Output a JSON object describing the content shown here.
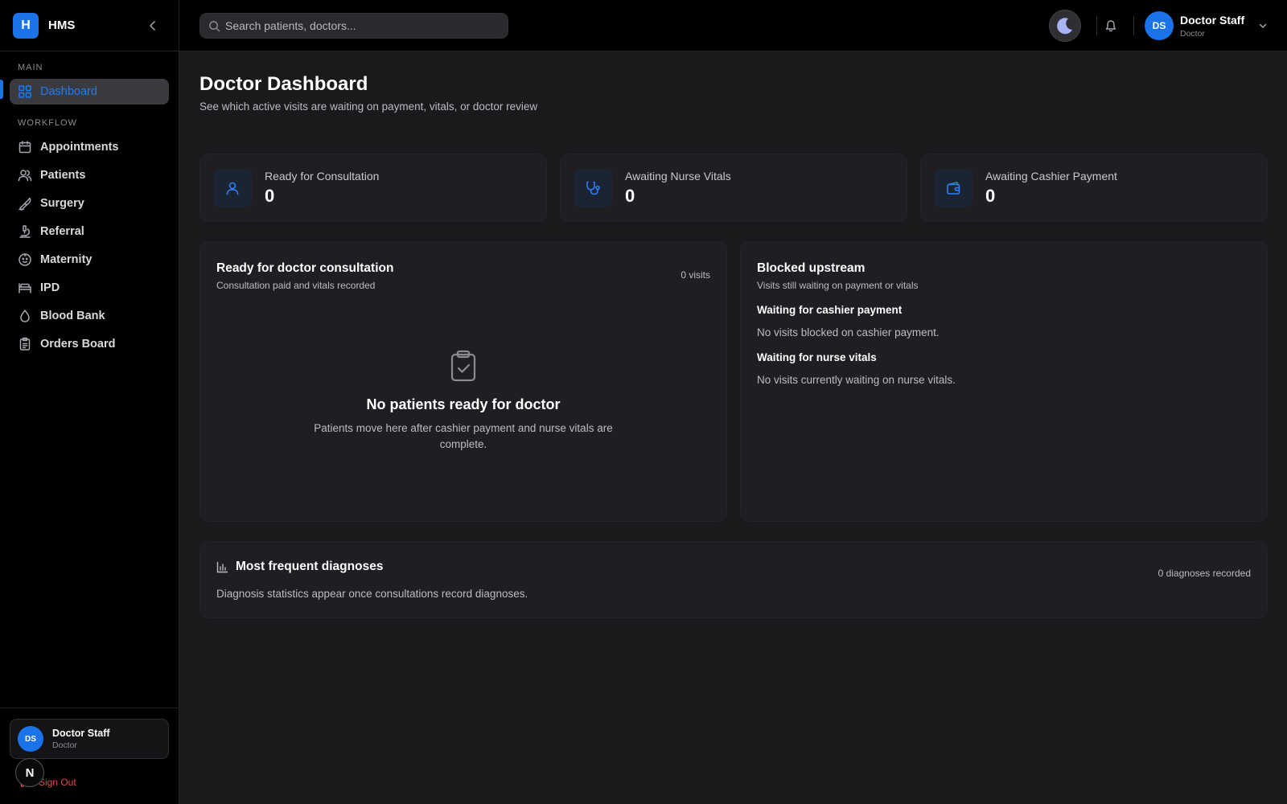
{
  "brand": {
    "logo_letter": "H",
    "name": "HMS"
  },
  "sidebar": {
    "sections": [
      {
        "label": "MAIN"
      },
      {
        "label": "WORKFLOW"
      }
    ],
    "items": [
      {
        "label": "Dashboard",
        "icon": "dashboard-icon"
      },
      {
        "label": "Appointments",
        "icon": "calendar-icon"
      },
      {
        "label": "Patients",
        "icon": "users-icon"
      },
      {
        "label": "Surgery",
        "icon": "scalpel-icon"
      },
      {
        "label": "Referral",
        "icon": "microscope-icon"
      },
      {
        "label": "Maternity",
        "icon": "baby-icon"
      },
      {
        "label": "IPD",
        "icon": "bed-icon"
      },
      {
        "label": "Blood Bank",
        "icon": "droplet-icon"
      },
      {
        "label": "Orders Board",
        "icon": "clipboard-icon"
      }
    ],
    "footer": {
      "avatar_initials": "DS",
      "user_name": "Doctor Staff",
      "user_role": "Doctor",
      "signout_label": "Sign Out",
      "n_badge": "N"
    }
  },
  "header": {
    "search_placeholder": "Search patients, doctors...",
    "profile": {
      "initials": "DS",
      "name": "Doctor Staff",
      "role": "Doctor"
    }
  },
  "page": {
    "title": "Doctor Dashboard",
    "subtitle": "See which active visits are waiting on payment, vitals, or doctor review"
  },
  "stats": [
    {
      "label": "Ready for Consultation",
      "value": "0",
      "icon": "user-icon"
    },
    {
      "label": "Awaiting Nurse Vitals",
      "value": "0",
      "icon": "stethoscope-icon"
    },
    {
      "label": "Awaiting Cashier Payment",
      "value": "0",
      "icon": "wallet-icon"
    }
  ],
  "ready_panel": {
    "title": "Ready for doctor consultation",
    "subtitle": "Consultation paid and vitals recorded",
    "count": "0 visits",
    "empty_title": "No patients ready for doctor",
    "empty_desc": "Patients move here after cashier payment and nurse vitals are complete."
  },
  "blocked_panel": {
    "title": "Blocked upstream",
    "subtitle": "Visits still waiting on payment or vitals",
    "cashier_heading": "Waiting for cashier payment",
    "cashier_text": "No visits blocked on cashier payment.",
    "vitals_heading": "Waiting for nurse vitals",
    "vitals_text": "No visits currently waiting on nurse vitals."
  },
  "diagnoses_panel": {
    "title": "Most frequent diagnoses",
    "count": "0 diagnoses recorded",
    "text": "Diagnosis statistics appear once consultations record diagnoses."
  },
  "colors": {
    "accent": "#1a73e8",
    "background": "#1a1a1d",
    "sidebar": "#000000",
    "card": "#1f1f23",
    "danger": "#e5484d"
  }
}
